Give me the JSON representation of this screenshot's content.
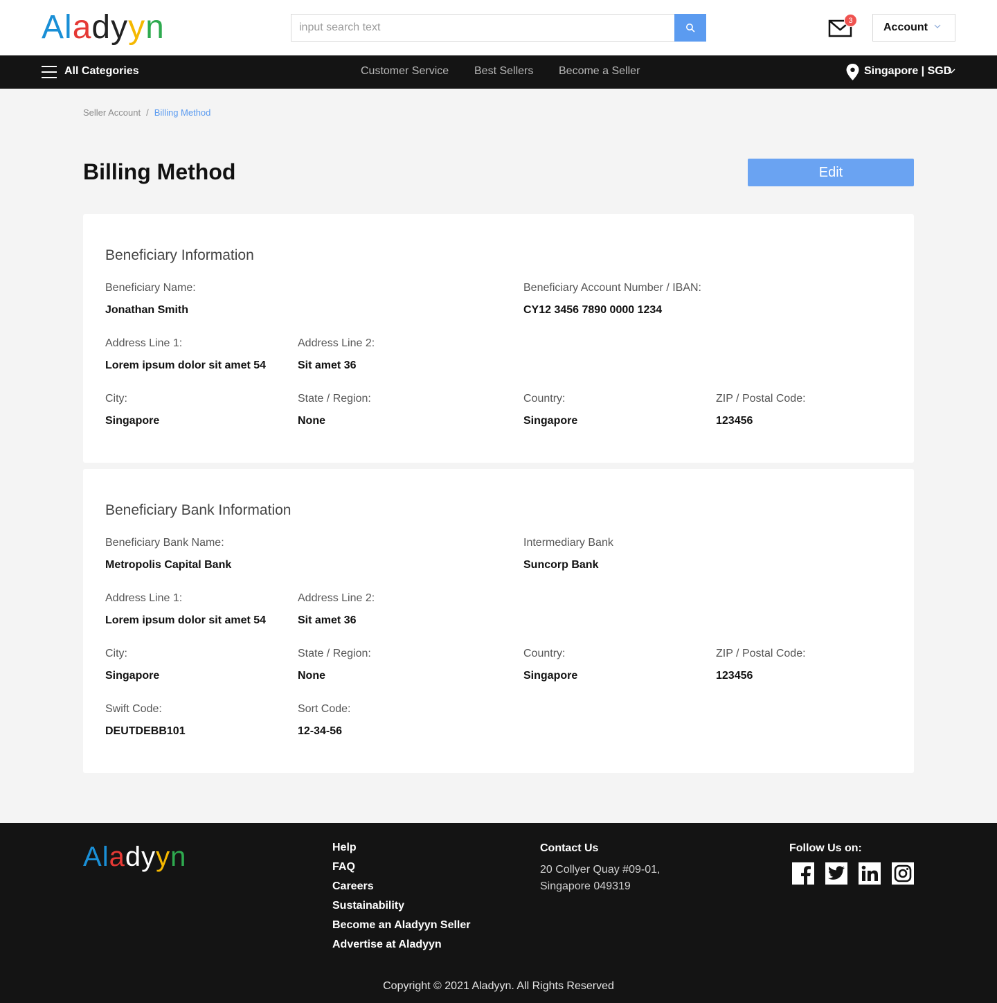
{
  "header": {
    "logo_letters": [
      {
        "ch": "A",
        "color": "#1a8fd6"
      },
      {
        "ch": "l",
        "color": "#1a8fd6"
      },
      {
        "ch": "a",
        "color": "#e53935"
      },
      {
        "ch": "d",
        "color": "#222222"
      },
      {
        "ch": "y",
        "color": "#222222"
      },
      {
        "ch": "y",
        "color": "#f5b800"
      },
      {
        "ch": "n",
        "color": "#2eaa4f"
      }
    ],
    "search_placeholder": "input search text",
    "search_value": "",
    "mail_badge": "3",
    "account_label": "Account"
  },
  "nav": {
    "all_categories": "All Categories",
    "links": [
      "Customer Service",
      "Best Sellers",
      "Become a Seller"
    ],
    "location": "Singapore | SGD"
  },
  "breadcrumb": {
    "parent": "Seller Account",
    "separator": "/",
    "current": "Billing Method"
  },
  "page": {
    "title": "Billing Method",
    "edit_label": "Edit"
  },
  "beneficiary": {
    "title": "Beneficiary Information",
    "name_label": "Beneficiary Name:",
    "name": "Jonathan Smith",
    "iban_label": "Beneficiary Account Number / IBAN:",
    "iban": "CY12 3456 7890 0000 1234",
    "addr1_label": "Address Line 1:",
    "addr1": "Lorem ipsum dolor sit amet 54",
    "addr2_label": "Address Line 2:",
    "addr2": "Sit amet 36",
    "city_label": "City:",
    "city": "Singapore",
    "state_label": "State / Region:",
    "state": "None",
    "country_label": "Country:",
    "country": "Singapore",
    "zip_label": "ZIP / Postal Code:",
    "zip": "123456"
  },
  "bank": {
    "title": "Beneficiary Bank Information",
    "bank_name_label": "Beneficiary Bank Name:",
    "bank_name": "Metropolis Capital Bank",
    "intermediary_label": "Intermediary Bank",
    "intermediary": "Suncorp Bank",
    "addr1_label": "Address Line 1:",
    "addr1": "Lorem ipsum dolor sit amet 54",
    "addr2_label": "Address Line 2:",
    "addr2": "Sit amet 36",
    "city_label": "City:",
    "city": "Singapore",
    "state_label": "State / Region:",
    "state": "None",
    "country_label": "Country:",
    "country": "Singapore",
    "zip_label": "ZIP / Postal Code:",
    "zip": "123456",
    "swift_label": "Swift Code:",
    "swift": "DEUTDEBB101",
    "sort_label": "Sort Code:",
    "sort": "12-34-56"
  },
  "footer": {
    "links": [
      "Help",
      "FAQ",
      "Careers",
      "Sustainability",
      "Become an Aladyyn Seller",
      "Advertise at Aladyyn"
    ],
    "contact_heading": "Contact Us",
    "contact_line1": "20 Collyer Quay #09-01,",
    "contact_line2": "Singapore 049319",
    "follow_heading": "Follow Us on:",
    "social_icons": [
      "facebook-icon",
      "twitter-icon",
      "linkedin-icon",
      "instagram-icon"
    ],
    "copyright": "Copyright © 2021 Aladyyn. All Rights Reserved"
  },
  "colors": {
    "accent": "#5b9bf0",
    "dark_bar": "#141414",
    "badge": "#ef5350"
  }
}
